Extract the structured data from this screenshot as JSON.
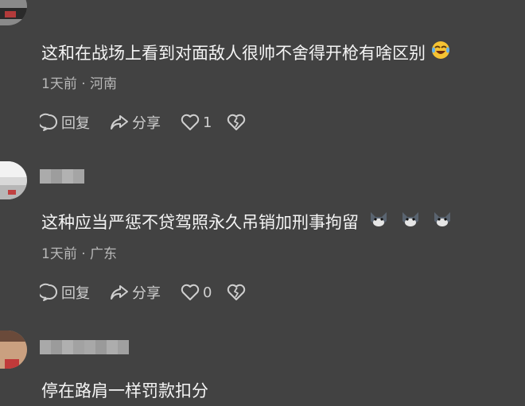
{
  "comments": [
    {
      "text": "这和在战场上看到对面敌人很帅不舍得开枪有啥区别",
      "trailing_emoji": "laughing-crying-emoji",
      "meta": "1天前 · 河南",
      "reply_label": "回复",
      "share_label": "分享",
      "like_count": "1"
    },
    {
      "text": "这种应当严惩不贷驾照永久吊销加刑事拘留",
      "trailing_emoji": "wolf-emoji",
      "meta": "1天前 · 广东",
      "reply_label": "回复",
      "share_label": "分享",
      "like_count": "0"
    },
    {
      "text": "停在路肩一样罚款扣分"
    }
  ],
  "colors": {
    "background": "#424242",
    "text": "#f4f4f4",
    "meta": "#b8b8b8",
    "icon": "#cfcfcf"
  }
}
